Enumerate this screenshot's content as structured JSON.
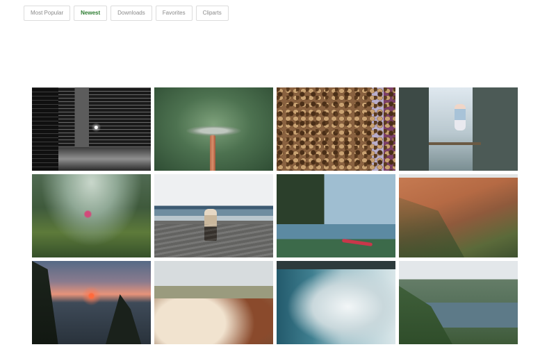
{
  "tabs": [
    {
      "label": "Most Popular",
      "active": false
    },
    {
      "label": "Newest",
      "active": true
    },
    {
      "label": "Downloads",
      "active": false
    },
    {
      "label": "Favorites",
      "active": false
    },
    {
      "label": "Cliparts",
      "active": false
    }
  ],
  "colors": {
    "active_tab": "#2e7d32",
    "inactive_tab": "#8a8a8a",
    "tab_border": "#dcdcdc"
  }
}
